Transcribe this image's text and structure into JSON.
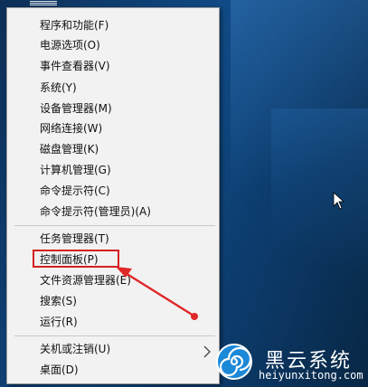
{
  "menu": {
    "items": [
      {
        "label": "程序和功能(F)"
      },
      {
        "label": "电源选项(O)"
      },
      {
        "label": "事件查看器(V)"
      },
      {
        "label": "系统(Y)"
      },
      {
        "label": "设备管理器(M)"
      },
      {
        "label": "网络连接(W)"
      },
      {
        "label": "磁盘管理(K)"
      },
      {
        "label": "计算机管理(G)"
      },
      {
        "label": "命令提示符(C)"
      },
      {
        "label": "命令提示符(管理员)(A)"
      },
      {
        "label": "任务管理器(T)"
      },
      {
        "label": "控制面板(P)"
      },
      {
        "label": "文件资源管理器(E)"
      },
      {
        "label": "搜索(S)"
      },
      {
        "label": "运行(R)"
      },
      {
        "label": "关机或注销(U)"
      },
      {
        "label": "桌面(D)"
      }
    ],
    "highlighted_item": "控制面板(P)",
    "highlight_color": "#d32020"
  },
  "watermark": {
    "title": "黑云系统",
    "url": "heiyunxitong.com"
  },
  "icons": {
    "submenu": "chevron-right-icon",
    "logo": "spiral-logo-icon",
    "cursor": "mouse-cursor-icon",
    "annotation": "red-arrow-icon"
  }
}
